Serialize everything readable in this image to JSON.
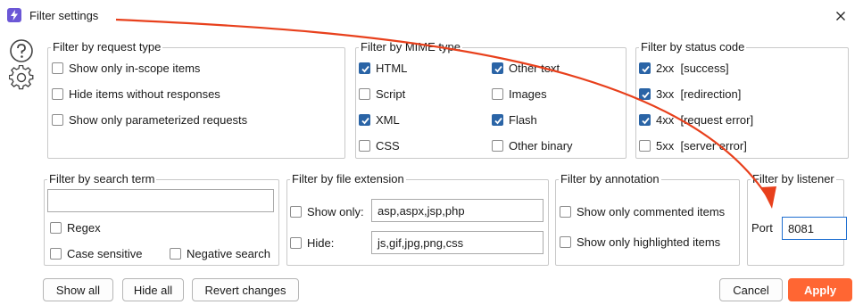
{
  "window": {
    "title": "Filter settings",
    "app_icon": "lightning-icon",
    "close_icon": "close-icon"
  },
  "side_icons": [
    "help-icon",
    "gear-icon"
  ],
  "request_type": {
    "legend": "Filter by request type",
    "items": [
      {
        "label": "Show only in-scope items",
        "checked": false
      },
      {
        "label": "Hide items without responses",
        "checked": false
      },
      {
        "label": "Show only parameterized requests",
        "checked": false
      }
    ]
  },
  "mime_type": {
    "legend": "Filter by MIME type",
    "items": [
      {
        "label": "HTML",
        "checked": true
      },
      {
        "label": "Other text",
        "checked": true
      },
      {
        "label": "Script",
        "checked": false
      },
      {
        "label": "Images",
        "checked": false
      },
      {
        "label": "XML",
        "checked": true
      },
      {
        "label": "Flash",
        "checked": true
      },
      {
        "label": "CSS",
        "checked": false
      },
      {
        "label": "Other binary",
        "checked": false
      }
    ]
  },
  "status_code": {
    "legend": "Filter by status code",
    "items": [
      {
        "label": "2xx  [success]",
        "checked": true
      },
      {
        "label": "3xx  [redirection]",
        "checked": true
      },
      {
        "label": "4xx  [request error]",
        "checked": true
      },
      {
        "label": "5xx  [server error]",
        "checked": false
      }
    ]
  },
  "search_term": {
    "legend": "Filter by search term",
    "value": "",
    "regex": {
      "label": "Regex",
      "checked": false
    },
    "case_sensitive": {
      "label": "Case sensitive",
      "checked": false
    },
    "negative_search": {
      "label": "Negative search",
      "checked": false
    }
  },
  "file_extension": {
    "legend": "Filter by file extension",
    "show_only": {
      "label": "Show only:",
      "checked": false,
      "value": "asp,aspx,jsp,php"
    },
    "hide": {
      "label": "Hide:",
      "checked": false,
      "value": "js,gif,jpg,png,css"
    }
  },
  "annotation": {
    "legend": "Filter by annotation",
    "items": [
      {
        "label": "Show only commented items",
        "checked": false
      },
      {
        "label": "Show only highlighted items",
        "checked": false
      }
    ]
  },
  "listener": {
    "legend": "Filter by listener",
    "port_label": "Port",
    "port_value": "8081"
  },
  "buttons": {
    "show_all": "Show all",
    "hide_all": "Hide all",
    "revert": "Revert changes",
    "cancel": "Cancel",
    "apply": "Apply"
  },
  "colors": {
    "accent": "#ff6633",
    "annotation_arrow": "#e8401c",
    "checkbox_checked": "#2a64a6",
    "app_icon": "#6b57d6"
  }
}
